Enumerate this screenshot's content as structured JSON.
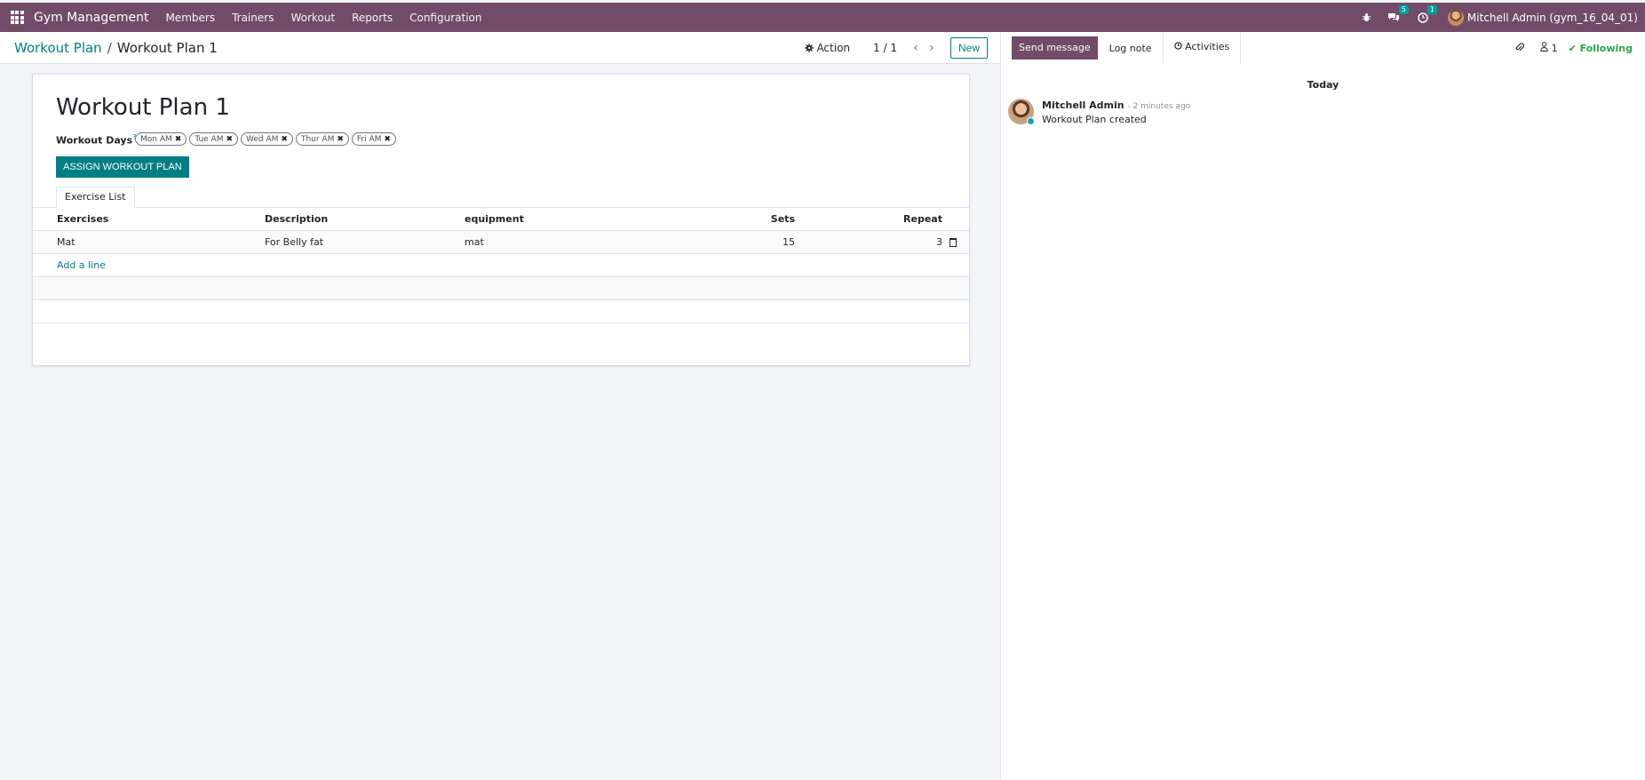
{
  "navbar": {
    "brand": "Gym Management",
    "menu": [
      "Members",
      "Trainers",
      "Workout",
      "Reports",
      "Configuration"
    ],
    "messages_count": "5",
    "activities_count": "1",
    "user": "Mitchell Admin (gym_16_04_01)"
  },
  "control": {
    "breadcrumb_parent": "Workout Plan",
    "breadcrumb_separator": "/",
    "breadcrumb_current": "Workout Plan 1",
    "action_label": "Action",
    "pager": "1 / 1",
    "new_label": "New"
  },
  "form": {
    "title": "Workout Plan 1",
    "workout_days_label": "Workout Days",
    "workout_days_help": "?",
    "tags": [
      "Mon AM",
      "Tue AM",
      "Wed AM",
      "Thur AM",
      "Fri AM"
    ],
    "assign_label": "ASSIGN WORKOUT PLAN",
    "tab_label": "Exercise List",
    "columns": [
      "Exercises",
      "Description",
      "equipment",
      "Sets",
      "Repeat"
    ],
    "rows": [
      {
        "exercise": "Mat",
        "description": "For Belly fat",
        "equipment": "mat",
        "sets": "15",
        "repeat": "3"
      }
    ],
    "add_line": "Add a line"
  },
  "chatter": {
    "send_message": "Send message",
    "log_note": "Log note",
    "activities": "Activities",
    "followers_count": "1",
    "following": "Following",
    "date_separator": "Today",
    "message": {
      "author": "Mitchell Admin",
      "time": "- 2 minutes ago",
      "body": "Workout Plan created"
    }
  },
  "colors": {
    "brand": "#714b67",
    "accent": "#017e84",
    "success": "#28a745"
  }
}
